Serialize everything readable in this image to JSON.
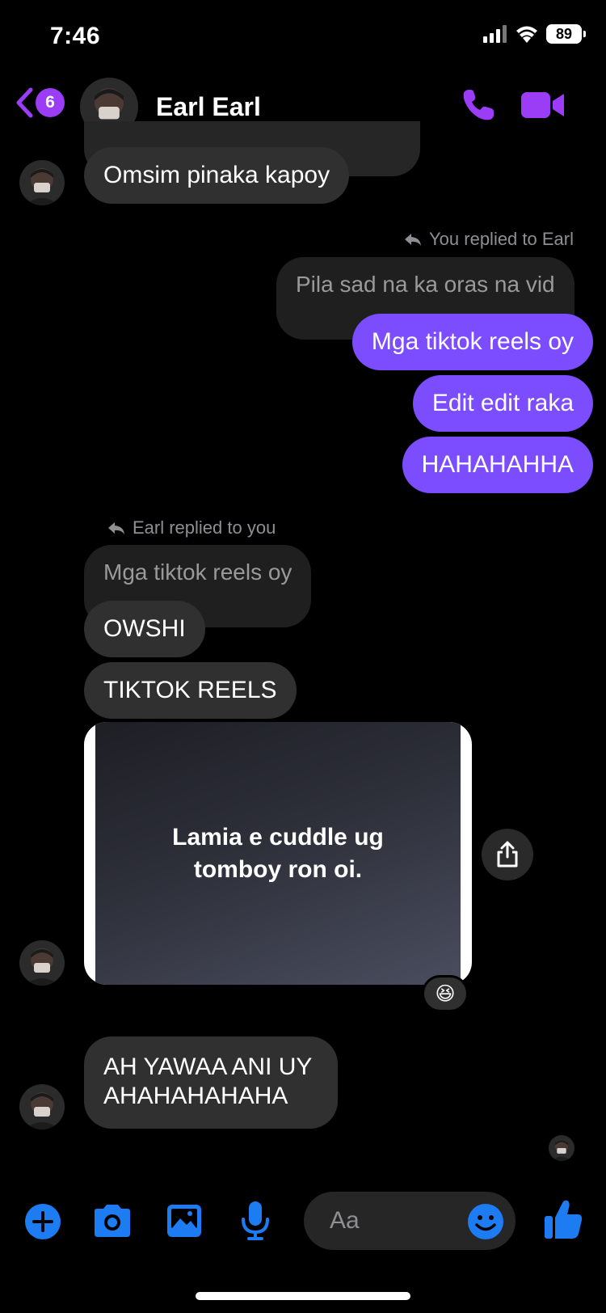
{
  "status_bar": {
    "time": "7:46",
    "battery": "89"
  },
  "header": {
    "back_badge": "6",
    "contact_name": "Earl Earl"
  },
  "messages": {
    "m1": "Omsim pinaka kapoy",
    "reply1_label": "You replied to Earl",
    "reply1_quote": "Pila sad na ka oras na vid",
    "m2": "Mga tiktok reels oy",
    "m3": "Edit edit raka",
    "m4": "HAHAHAHHA",
    "reply2_label": "Earl replied to you",
    "reply2_quote": "Mga tiktok reels oy",
    "m5": "OWSHI",
    "m6": "TIKTOK REELS",
    "reel_line1": "Lamia e cuddle ug",
    "reel_line2": "tomboy ron oi.",
    "reaction": "😆",
    "m7_line1": "AH YAWAA ANI UY",
    "m7_line2": "AHAHAHAHAHA"
  },
  "composer": {
    "placeholder": "Aa"
  },
  "icons": {
    "back": "chevron-left-icon",
    "call": "phone-icon",
    "video": "video-camera-icon",
    "plus": "plus-circle-icon",
    "camera": "camera-icon",
    "gallery": "image-icon",
    "mic": "microphone-icon",
    "emoji": "smiley-icon",
    "like": "thumbs-up-icon",
    "share": "share-icon"
  },
  "colors": {
    "accent_purple": "#9b3cf7",
    "outgoing_bubble": "#7b4dff",
    "composer_blue": "#1e7cf2",
    "incoming_bubble": "#303030"
  }
}
